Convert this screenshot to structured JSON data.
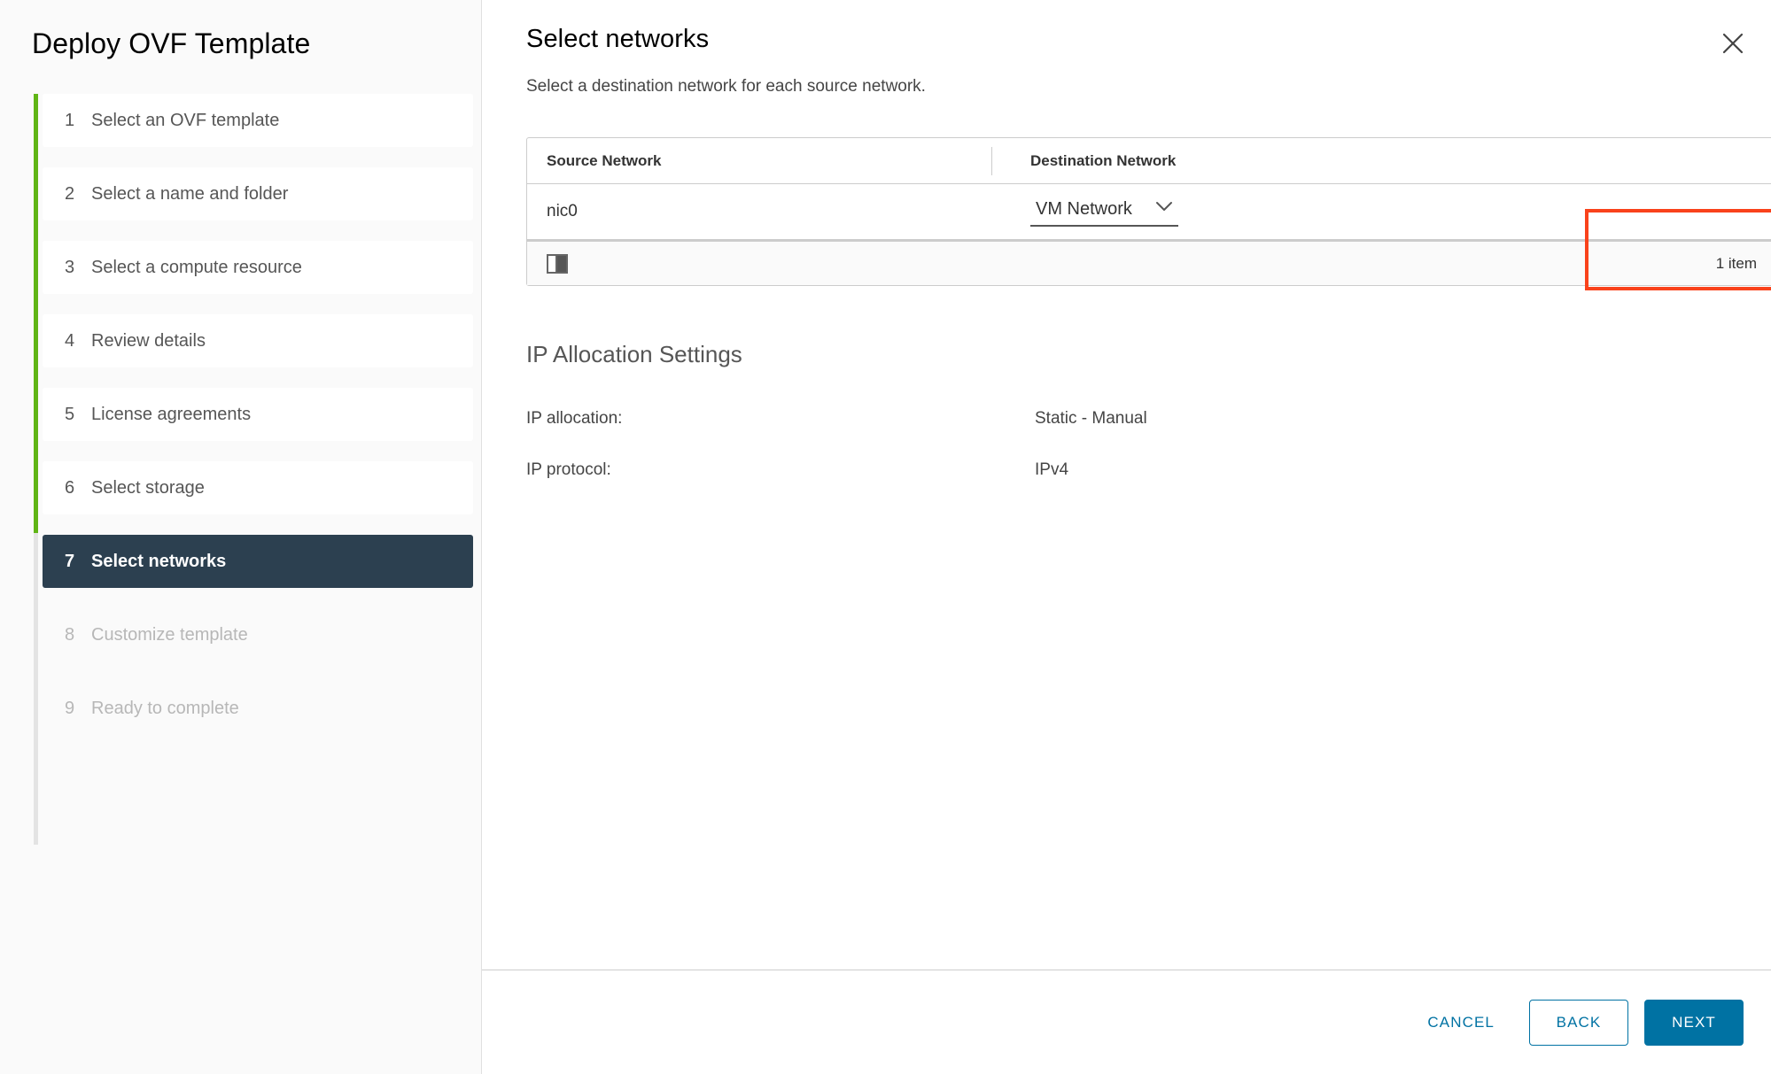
{
  "wizard": {
    "title": "Deploy OVF Template",
    "close_icon": "close-icon",
    "steps": [
      {
        "num": "1",
        "label": "Select an OVF template",
        "state": "complete"
      },
      {
        "num": "2",
        "label": "Select a name and folder",
        "state": "complete"
      },
      {
        "num": "3",
        "label": "Select a compute resource",
        "state": "complete"
      },
      {
        "num": "4",
        "label": "Review details",
        "state": "complete"
      },
      {
        "num": "5",
        "label": "License agreements",
        "state": "complete"
      },
      {
        "num": "6",
        "label": "Select storage",
        "state": "complete"
      },
      {
        "num": "7",
        "label": "Select networks",
        "state": "active"
      },
      {
        "num": "8",
        "label": "Customize template",
        "state": "disabled"
      },
      {
        "num": "9",
        "label": "Ready to complete",
        "state": "disabled"
      }
    ]
  },
  "page": {
    "title": "Select networks",
    "subtitle": "Select a destination network for each source network."
  },
  "network_table": {
    "columns": [
      "Source Network",
      "Destination Network"
    ],
    "rows": [
      {
        "source": "nic0",
        "destination": "VM Network"
      }
    ],
    "destination_chevron_icon": "chevron-down-icon",
    "footer_columns_icon": "column-toggle-icon",
    "footer_count": "1 item"
  },
  "ip_allocation": {
    "heading": "IP Allocation Settings",
    "rows": [
      {
        "label": "IP allocation:",
        "value": "Static - Manual"
      },
      {
        "label": "IP protocol:",
        "value": "IPv4"
      }
    ]
  },
  "actions": {
    "cancel": "CANCEL",
    "back": "BACK",
    "next": "NEXT"
  },
  "colors": {
    "progress_complete": "#60b515",
    "progress_pending": "#e3e3e3",
    "active_step_bg": "#2c4050",
    "primary_button": "#0072a3",
    "annotation_highlight": "#f9421b"
  }
}
